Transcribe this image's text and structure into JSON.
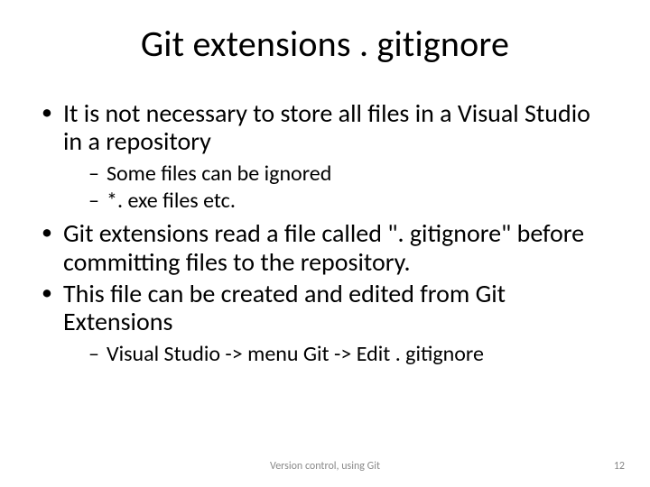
{
  "title": "Git extensions . gitignore",
  "bullets": [
    {
      "text": "It is not necessary to store all files in a Visual Studio in a repository",
      "sub": [
        "Some files can be ignored",
        "*. exe files etc."
      ]
    },
    {
      "text": "Git extensions read a file called \". gitignore\" before committing files to the repository.",
      "sub": []
    },
    {
      "text": "This file can be created and edited from Git Extensions",
      "sub": [
        "Visual Studio -> menu Git -> Edit . gitignore"
      ]
    }
  ],
  "footer": {
    "center": "Version control, using Git",
    "page": "12"
  }
}
